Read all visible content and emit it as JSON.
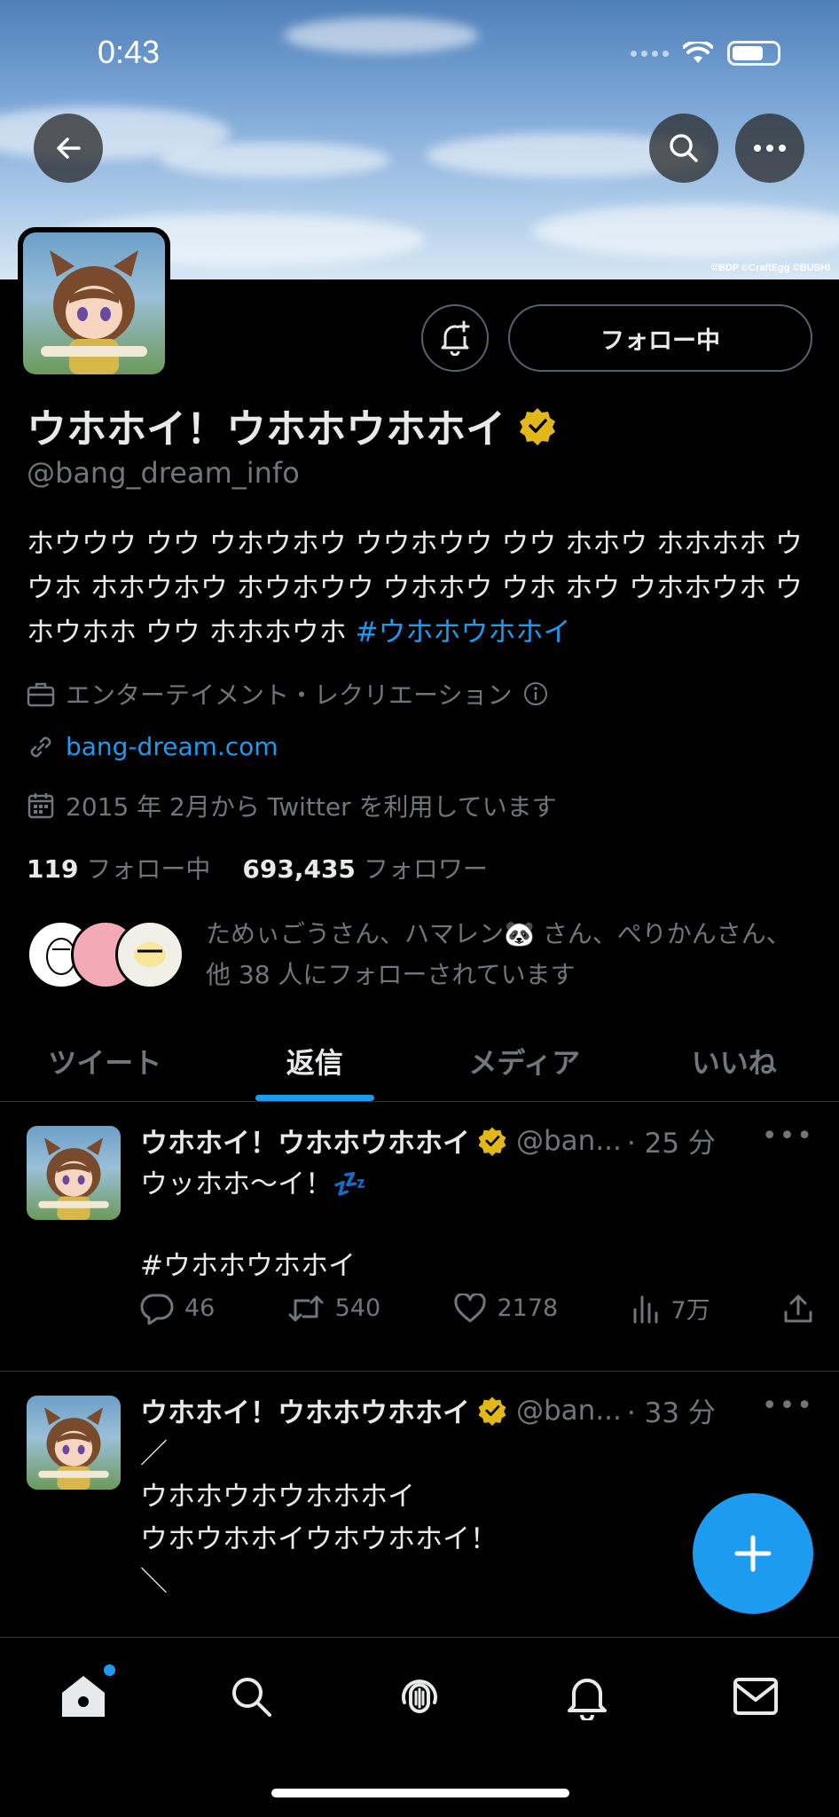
{
  "status_bar": {
    "time": "0:43"
  },
  "banner": {
    "copyright": "©BDP ©CraftEgg ©BUSHI"
  },
  "profile": {
    "name": "ウホホイ！ウホホウホホイ",
    "handle": "@bang_dream_info",
    "follow_label": "フォロー中",
    "bio_text": "ホウウウ ウウ ウホウホウ ウウホウウ ウウ ホホウ ホホホホ ウウホ ホホウホウ ホウホウウ ウホホウ ウホ ホウ ウホホウホ ウホウホホ ウウ ホホホウホ ",
    "bio_hashtag": "#ウホホウホホイ",
    "category": "エンターテイメント・レクリエーション",
    "website": "bang-dream.com",
    "joined": "2015 年 2月から Twitter を利用しています",
    "following_count": "119",
    "following_label": "フォロー中",
    "followers_count": "693,435",
    "followers_label": "フォロワー",
    "followed_by": "ためぃごうさん、ハマレン🐼 さん、ぺりかんさん、他 38 人にフォローされています"
  },
  "tabs": [
    "ツイート",
    "返信",
    "メディア",
    "いいね"
  ],
  "active_tab": "返信",
  "tweets": [
    {
      "name": "ウホホイ！ウホホウホホイ",
      "handle": "@ban...",
      "time": "· 25 分",
      "text": "ウッホホ〜イ！💤",
      "hashtag": "#ウホホウホホイ",
      "replies": "46",
      "retweets": "540",
      "likes": "2178",
      "views": "7万"
    },
    {
      "name": "ウホホイ！ウホホウホホイ",
      "handle": "@ban...",
      "time": "· 33 分",
      "text": "／\nウホホウホウホホホイ\nウホウホホイウホウホホイ！\n＼"
    }
  ],
  "colors": {
    "accent": "#1d9bf0",
    "verified": "#e2b719",
    "muted": "#71767b"
  }
}
